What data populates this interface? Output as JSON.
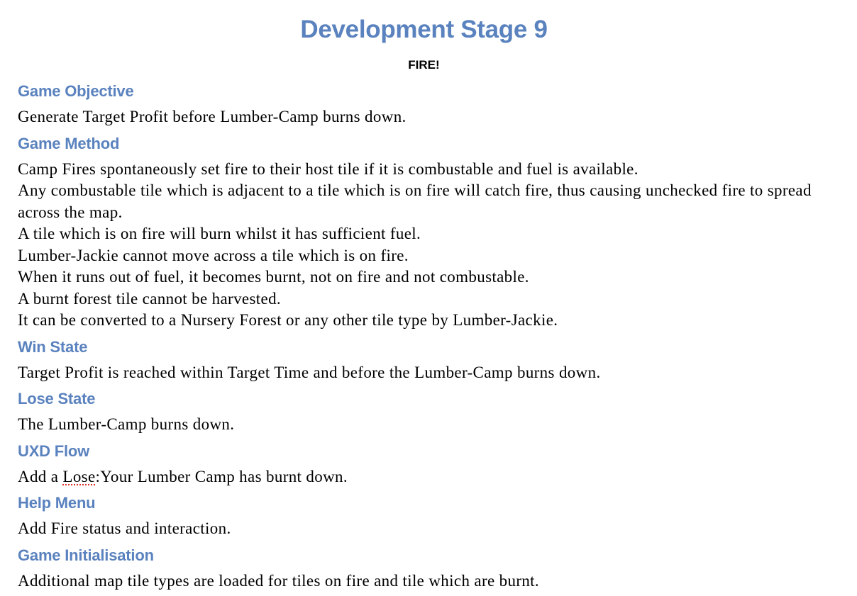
{
  "title": "Development Stage 9",
  "subtitle": "FIRE!",
  "sections": [
    {
      "heading": "Game Objective",
      "lines": [
        "Generate Target Profit before Lumber-Camp burns down."
      ]
    },
    {
      "heading": "Game Method",
      "lines": [
        "Camp Fires spontaneously set fire to their host tile if it is combustable and fuel is available.",
        "Any combustable tile which is adjacent to a tile which is on fire will catch fire, thus causing unchecked fire to spread across the map.",
        "A tile which is on fire will burn whilst it has sufficient fuel.",
        "Lumber-Jackie cannot move across a tile which is on fire.",
        "When it runs out of fuel, it becomes burnt, not on fire and not combustable.",
        "A burnt forest tile cannot be harvested.",
        "It can be converted to a Nursery Forest or any other tile type by Lumber-Jackie."
      ]
    },
    {
      "heading": "Win State",
      "lines": [
        "Target Profit is reached within Target Time and before the Lumber-Camp burns down."
      ]
    },
    {
      "heading": "Lose State",
      "lines": [
        "The Lumber-Camp burns down."
      ]
    },
    {
      "heading": "UXD Flow",
      "parts": [
        "Add a ",
        "Lose",
        ":Your Lumber Camp has burnt down."
      ]
    },
    {
      "heading": "Help Menu",
      "lines": [
        "Add Fire status and interaction."
      ]
    },
    {
      "heading": "Game Initialisation",
      "lines": [
        "Additional map tile types are loaded for tiles on fire and tile which are burnt."
      ]
    }
  ]
}
